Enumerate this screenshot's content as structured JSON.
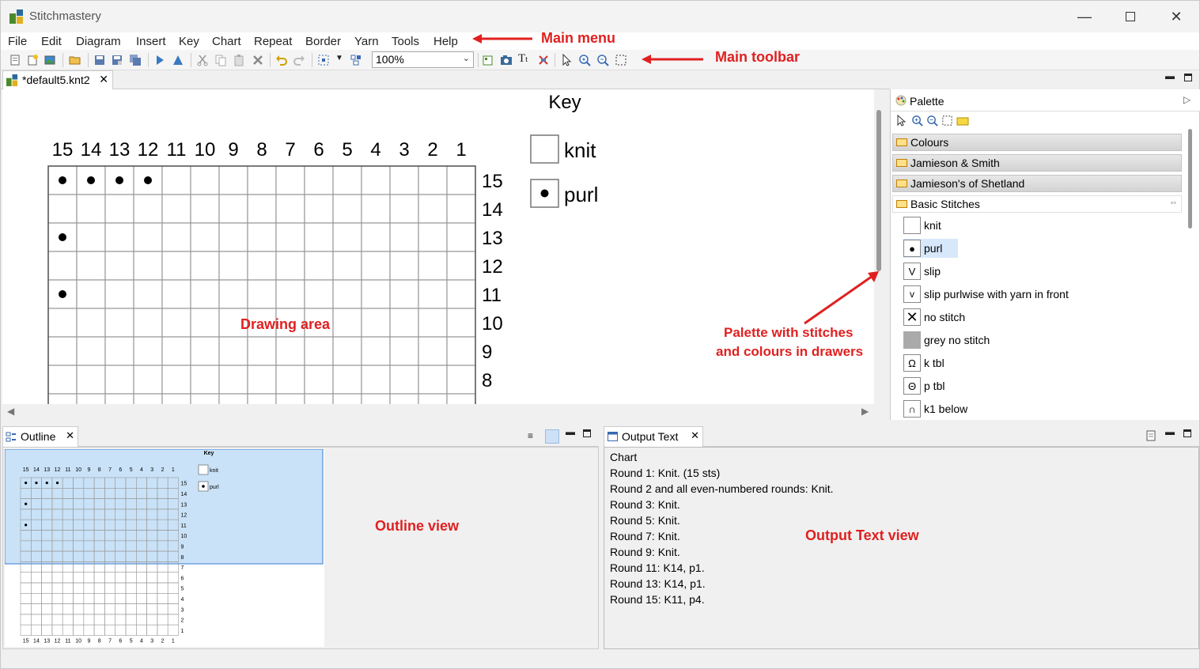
{
  "app": {
    "title": "Stitchmastery"
  },
  "menu": [
    "File",
    "Edit",
    "Diagram",
    "Insert",
    "Key",
    "Chart",
    "Repeat",
    "Border",
    "Yarn",
    "Tools",
    "Help"
  ],
  "toolbar": {
    "zoom": "100%"
  },
  "annotations": {
    "main_menu": "Main menu",
    "main_toolbar": "Main toolbar",
    "drawing_area": "Drawing area",
    "palette_line1": "Palette with stitches",
    "palette_line2": "and colours in drawers",
    "outline_view": "Outline view",
    "output_view": "Output Text view"
  },
  "editor": {
    "tab": "*default5.knt2"
  },
  "chart": {
    "key_title": "Key",
    "col_labels": [
      "15",
      "14",
      "13",
      "12",
      "11",
      "10",
      "9",
      "8",
      "7",
      "6",
      "5",
      "4",
      "3",
      "2",
      "1"
    ],
    "row_labels": [
      "15",
      "14",
      "13",
      "12",
      "11",
      "10",
      "9",
      "8"
    ],
    "all_rows": [
      "15",
      "14",
      "13",
      "12",
      "11",
      "10",
      "9",
      "8",
      "7",
      "6",
      "5",
      "4",
      "3",
      "2",
      "1"
    ],
    "purl_cells": [
      [
        15,
        15
      ],
      [
        15,
        14
      ],
      [
        15,
        13
      ],
      [
        15,
        12
      ],
      [
        13,
        15
      ],
      [
        11,
        15
      ]
    ],
    "key_items": [
      {
        "symbol": "knit",
        "label": "knit"
      },
      {
        "symbol": "purl",
        "label": "purl"
      }
    ]
  },
  "palette": {
    "title": "Palette",
    "drawers": [
      "Colours",
      "Jamieson & Smith",
      "Jamieson's of Shetland",
      "Basic Stitches"
    ],
    "items": [
      {
        "label": "knit",
        "icon": "knit-icon"
      },
      {
        "label": "purl",
        "icon": "purl-icon"
      },
      {
        "label": "slip",
        "icon": "slip-icon"
      },
      {
        "label": "slip purlwise with yarn in front",
        "icon": "slip-wyif-icon"
      },
      {
        "label": "no stitch",
        "icon": "no-stitch-icon"
      },
      {
        "label": "grey no stitch",
        "icon": "grey-no-stitch-icon"
      },
      {
        "label": "k tbl",
        "icon": "k-tbl-icon"
      },
      {
        "label": "p tbl",
        "icon": "p-tbl-icon"
      },
      {
        "label": "k1 below",
        "icon": "k1-below-icon"
      }
    ],
    "selected": "purl"
  },
  "outline": {
    "tab": "Outline"
  },
  "output": {
    "tab": "Output Text",
    "lines": [
      "Chart",
      "Round 1: Knit. (15 sts)",
      "Round 2 and all even-numbered rounds: Knit.",
      "Round 3: Knit.",
      "Round 5: Knit.",
      "Round 7: Knit.",
      "Round 9: Knit.",
      "Round 11: K14, p1.",
      "Round 13: K14, p1.",
      "Round 15: K11, p4."
    ]
  }
}
